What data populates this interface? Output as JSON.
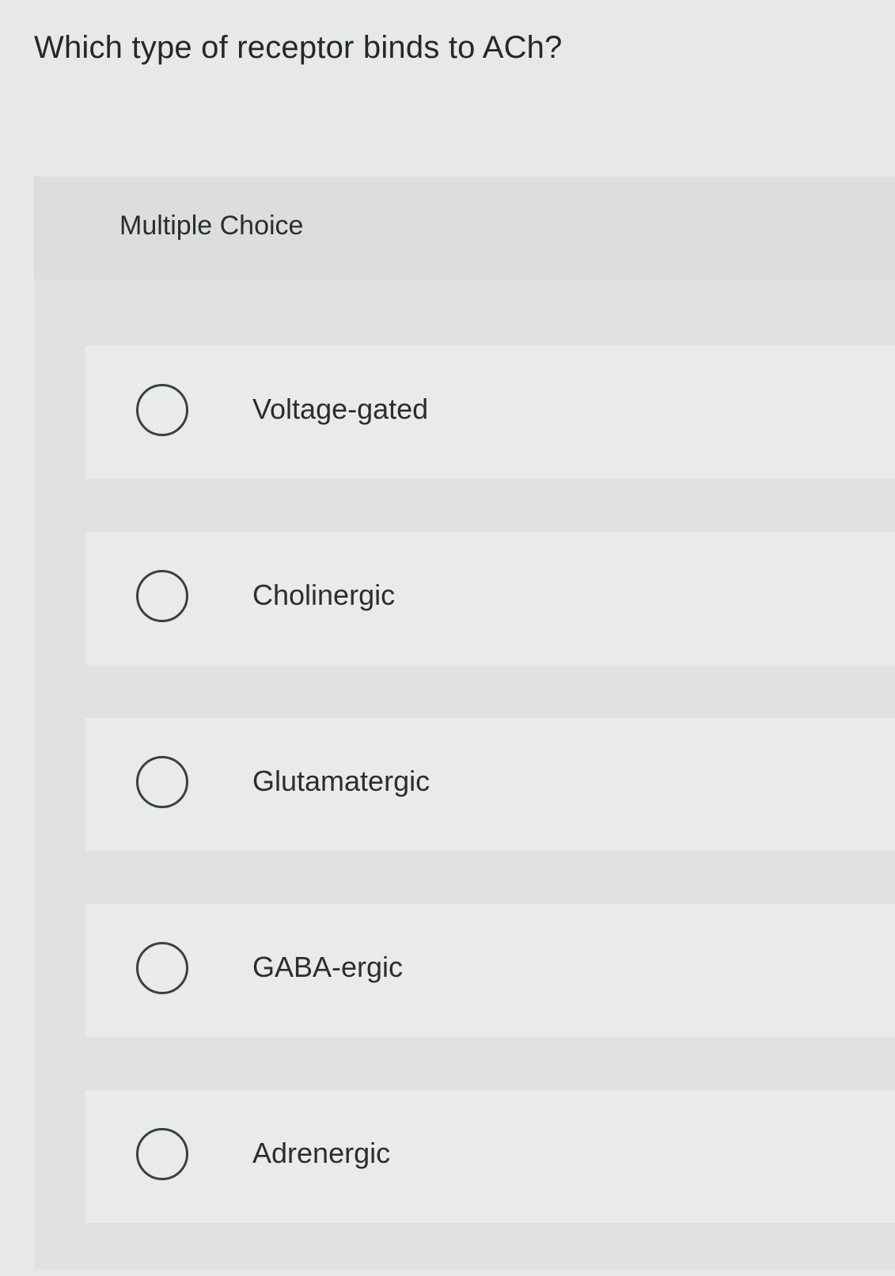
{
  "question": {
    "text": "Which type of receptor binds to ACh?"
  },
  "panel": {
    "title": "Multiple Choice"
  },
  "options": [
    {
      "label": "Voltage-gated"
    },
    {
      "label": "Cholinergic"
    },
    {
      "label": "Glutamatergic"
    },
    {
      "label": "GABA-ergic"
    },
    {
      "label": "Adrenergic"
    }
  ],
  "colors": {
    "page_background": "#e7e9e7",
    "panel_background": "#e0e2e0",
    "option_background": "#e9ebe9",
    "radio_border": "#3a3f44",
    "text": "#24282b"
  }
}
